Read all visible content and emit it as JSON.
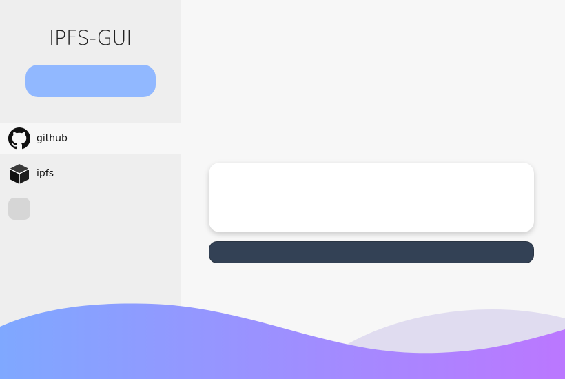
{
  "app": {
    "title": "IPFS-GUI"
  },
  "sidebar": {
    "items": [
      {
        "label": "github",
        "icon": "github-icon",
        "active": true
      },
      {
        "label": "ipfs",
        "icon": "cube-icon",
        "active": false
      }
    ]
  },
  "colors": {
    "sidebar_bg": "#eeeeee",
    "main_bg": "#f7f7f7",
    "accent_button": "#91b8ff",
    "dark_bar": "#334155",
    "wave_gradient_start": "#7fa8ff",
    "wave_gradient_end": "#bb77ff",
    "wave_back": "#e0dcf0"
  }
}
